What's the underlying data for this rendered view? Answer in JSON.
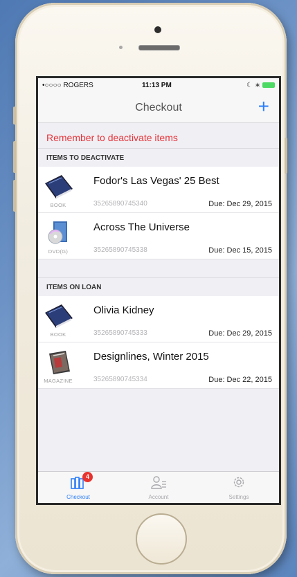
{
  "status_bar": {
    "carrier": "•○○○○ ROGERS",
    "time": "11:13 PM",
    "right": "☾ ∗"
  },
  "nav": {
    "title": "Checkout",
    "add_label": "+"
  },
  "notice": "Remember to deactivate items",
  "sections": [
    {
      "header": "ITEMS TO DEACTIVATE",
      "items": [
        {
          "title": "Fodor's Las Vegas' 25 Best",
          "type": "BOOK",
          "barcode": "35265890745340",
          "due": "Due: Dec 29, 2015",
          "icon": "book-icon"
        },
        {
          "title": "Across The Universe",
          "type": "DVD(G)",
          "barcode": "35265890745338",
          "due": "Due: Dec 15, 2015",
          "icon": "dvd-icon"
        }
      ]
    },
    {
      "header": "ITEMS ON LOAN",
      "items": [
        {
          "title": "Olivia Kidney",
          "type": "BOOK",
          "barcode": "35265890745333",
          "due": "Due: Dec 29, 2015",
          "icon": "book-icon"
        },
        {
          "title": "Designlines, Winter 2015",
          "type": "MAGAZINE",
          "barcode": "35265890745334",
          "due": "Due: Dec 22, 2015",
          "icon": "magazine-icon"
        }
      ]
    }
  ],
  "tabs": [
    {
      "label": "Checkout",
      "icon": "books-icon",
      "badge": "4",
      "active": true
    },
    {
      "label": "Account",
      "icon": "account-icon"
    },
    {
      "label": "Settings",
      "icon": "gear-icon"
    }
  ],
  "colors": {
    "accent": "#2d7ff9",
    "notice": "#e4353a",
    "badge": "#e8322d",
    "battery": "#4cd964"
  }
}
